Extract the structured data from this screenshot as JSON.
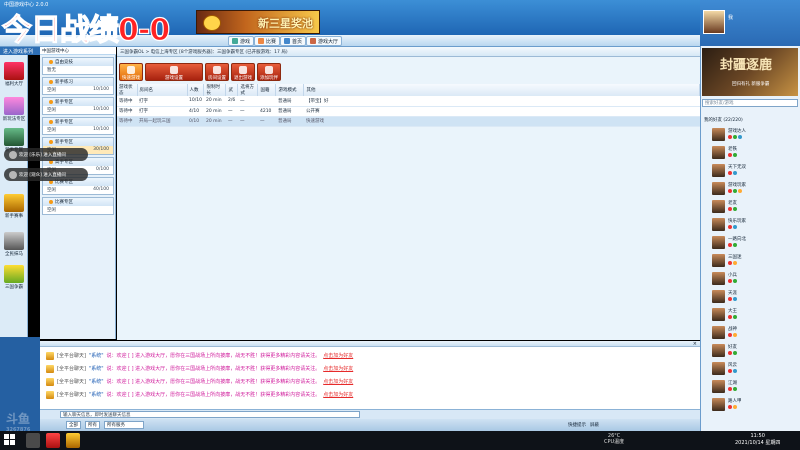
{
  "overlay": {
    "stream_text": "今日战绩0-0"
  },
  "window": {
    "title": "中国游戏中心 2.0.0"
  },
  "topnav": {
    "items": [
      "游戏",
      "比赛",
      "首页",
      "游戏大厅"
    ]
  },
  "ad": {
    "text": "新三星奖池"
  },
  "left": {
    "header": "进入游戏系列",
    "items": [
      "福利大厅",
      "新玩法专区",
      "新手专属",
      "新手赛事",
      "全民抹马",
      "三国争霸"
    ]
  },
  "tree": {
    "header": "中国游戏中心",
    "zones": [
      {
        "title": "自由竞技",
        "name": "暂无",
        "count": ""
      },
      {
        "title": "新手练习",
        "name": "空闲",
        "count": "10/100"
      },
      {
        "title": "新手专区",
        "name": "空闲",
        "count": "10/100"
      },
      {
        "title": "新手专区",
        "name": "空闲",
        "count": "10/100"
      },
      {
        "title": "新手专区",
        "name": "空闲",
        "count": "30/100"
      },
      {
        "title": "高手专区",
        "name": "空闲",
        "count": "0/100"
      },
      {
        "title": "比赛专区",
        "name": "空闲",
        "count": "40/100"
      },
      {
        "title": "比赛专区",
        "name": "空闲",
        "count": ""
      }
    ]
  },
  "bubbles": [
    "欢迎 [乐乐] 进入直播间",
    "欢迎 [观众] 进入直播间"
  ],
  "main": {
    "title": "三国争霸OL > 电信上海专区 [8个游戏服务器]：三国争霸专区 (已开服游戏：17 局)",
    "toolbar": [
      "快速游戏",
      "游戏设置",
      "房间设置",
      "退出游戏",
      "添加玩伴"
    ],
    "columns": [
      "游戏状态",
      "房间名",
      "人数",
      "限制时长",
      "武",
      "选将方式",
      "国籍",
      "游戏模式",
      "其他"
    ],
    "rows": [
      [
        "等待中",
        "打字",
        "10/10",
        "20 min",
        "2/6",
        "一",
        "",
        "普通局",
        "【带宝】好"
      ],
      [
        "等待中",
        "打字",
        "4/10",
        "20 min",
        "一",
        "一",
        "4210",
        "普通局",
        "公开赛"
      ],
      [
        "等待中",
        "开局一起玩三国",
        "0/10",
        "20 min",
        "一",
        "一",
        "一",
        "普通局",
        "快速游戏"
      ]
    ]
  },
  "chat": {
    "messages": [
      {
        "tag": "[全平台聊天]",
        "name": "\"系统\"",
        "body": "说：欢迎 [ ] 进入游戏大厅，愿你在三国战场上所向披靡，战无不胜！获得更多精彩内容请关注。",
        "link": "点击加为好友"
      },
      {
        "tag": "[全平台聊天]",
        "name": "\"系统\"",
        "body": "说：欢迎 [ ] 进入游戏大厅，愿你在三国战场上所向披靡，战无不胜！获得更多精彩内容请关注。",
        "link": "点击加为好友"
      },
      {
        "tag": "[全平台聊天]",
        "name": "\"系统\"",
        "body": "说：欢迎 [ ] 进入游戏大厅，愿你在三国战场上所向披靡，战无不胜！获得更多精彩内容请关注。",
        "link": "点击加为好友"
      },
      {
        "tag": "[全平台聊天]",
        "name": "\"系统\"",
        "body": "说：欢迎 [ ] 进入游戏大厅，愿你在三国战场上所向披靡，战无不胜！获得更多精彩内容请关注。",
        "link": "点击加为好友"
      }
    ],
    "input_placeholder": "输入聊天信息，即时发送聊天信息",
    "status": {
      "sel1": "全部",
      "sel2": "所有",
      "sel3": "所有服务",
      "pref": "快捷提示",
      "hide": "屏蔽"
    }
  },
  "right": {
    "username": "我",
    "ad_title": "封疆逐鹿",
    "ad_sub": "回归有礼 新服争霸",
    "search_placeholder": "搜索好友/游戏",
    "friends_header": "我的好友 (22/220)",
    "friends": [
      "游戏达人",
      "老铁",
      "天下无双",
      "游戏玩家",
      "老友",
      "快乐玩家",
      "一路向北",
      "三国迷",
      "小兵",
      "天涯",
      "大王",
      "战神",
      "好友",
      "风云",
      "江湖",
      "路人甲"
    ]
  },
  "taskbar": {
    "weather": "26°C",
    "weather_sub": "CPU温度",
    "time": "11:50",
    "date": "2021/10/14 星期四"
  },
  "watermark": {
    "brand": "斗鱼",
    "room": "3267876"
  },
  "colors": {
    "accent": "#1f66b4",
    "chat_body": "#d01c9c",
    "chat_link": "#e62a2a",
    "overlay": "#ff2222"
  }
}
